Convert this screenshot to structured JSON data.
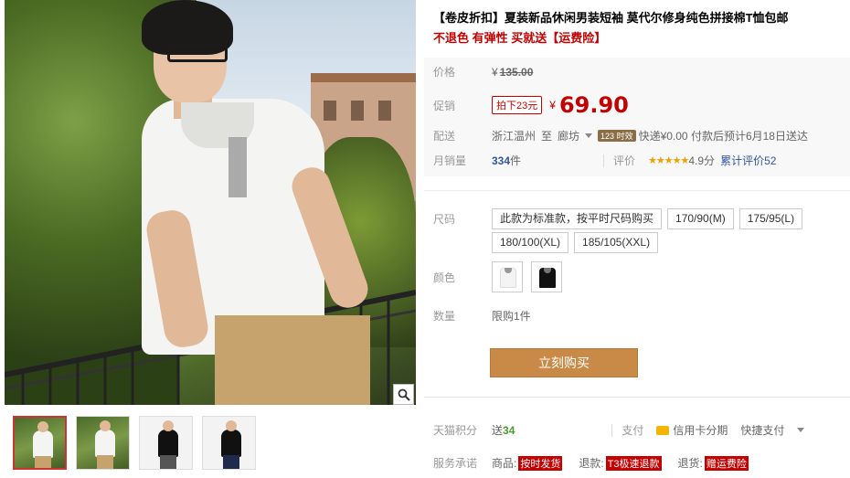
{
  "product": {
    "title": "【卷皮折扣】夏装新品休闲男装短袖 莫代尔修身纯色拼接棉T恤包邮",
    "subtitle": "不退色 有弹性 买就送【运费险】"
  },
  "price": {
    "label": "价格",
    "currency": "¥",
    "original": "135.00"
  },
  "promo": {
    "label": "促销",
    "tag": "拍下23元",
    "currency": "¥",
    "value": "69.90"
  },
  "shipping": {
    "label": "配送",
    "from": "浙江温州",
    "to_word": "至",
    "dest": "廊坊",
    "badge": "123 时效",
    "text": "快递¥0.00 付款后预计6月18日送达"
  },
  "sales": {
    "label": "月销量",
    "count": "334",
    "unit": "件",
    "rating_label": "评价",
    "stars": "★★★★★",
    "score": "4.9分",
    "total_reviews": "累计评价52"
  },
  "size": {
    "label": "尺码",
    "options": [
      "此款为标准款，按平时尺码购买",
      "170/90(M)",
      "175/95(L)",
      "180/100(XL)",
      "185/105(XXL)"
    ]
  },
  "color": {
    "label": "颜色",
    "swatches": [
      "white-shirt",
      "black-shirt"
    ]
  },
  "quantity": {
    "label": "数量",
    "limit": "限购1件"
  },
  "buy_button": "立刻购买",
  "points": {
    "label": "天猫积分",
    "prefix": "送",
    "value": "34"
  },
  "payment": {
    "label": "支付",
    "credit": "信用卡分期",
    "quick": "快捷支付"
  },
  "service": {
    "label": "服务承诺",
    "goods_label": "商品:",
    "goods_tag": "按时发货",
    "refund_label": "退款:",
    "refund_tag": "T3极速退款",
    "return_label": "退货:",
    "return_tag": "赠运费险"
  },
  "icons": {
    "zoom": "magnifier-icon",
    "dropdown": "chevron-down-icon",
    "card": "credit-card-icon"
  },
  "colors": {
    "accent_red": "#c40000",
    "buy_button": "#c98a48",
    "link_blue": "#33569e"
  }
}
